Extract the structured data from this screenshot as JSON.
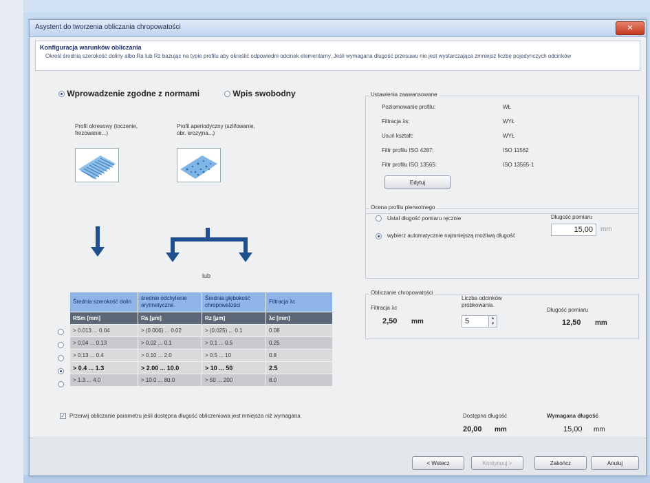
{
  "window": {
    "title": "Asystent do tworzenia obliczania chropowatości",
    "close": "✕"
  },
  "header": {
    "title": "Konfiguracja warunków obliczania",
    "description": "Określ średnią szerokość doliny albo Ra lub Rz bazując na typie profilu aby określić odpowiedni odcinek elementarny. Jeśli wymagana długość przesuwu nie jest wystarczająca zmniejsz liczbę pojedynczych odcinków"
  },
  "mode": {
    "norm_label": "Wprowadzenie zgodne z normami",
    "free_label": "Wpis swobodny",
    "selected": "norm"
  },
  "profiles": {
    "periodic_label": "Profil okresowy (toczenie, frezowanie...)",
    "aperiodic_label": "Profil aperiodyczny (szlifowanie, obr. erozyjna...)",
    "lub": "lub"
  },
  "table": {
    "headers": [
      "Średnia szerokość dolin",
      "średnie odchylenie arytmetyczne",
      "Średnia głębokość chropowatości",
      "Filtracja λc"
    ],
    "units": [
      "RSm [mm]",
      "Ra [μm]",
      "Rz [μm]",
      "λc [mm]"
    ],
    "rows": [
      [
        "> 0.013 ... 0.04",
        "> (0.006) ... 0.02",
        "> (0.025) ... 0.1",
        "0.08"
      ],
      [
        "> 0.04 ... 0.13",
        "> 0.02 ... 0.1",
        "> 0.1 ... 0.5",
        "0.25"
      ],
      [
        "> 0.13 ... 0.4",
        "> 0.10 ... 2.0",
        "> 0.5 ... 10",
        "0.8"
      ],
      [
        "> 0.4 ... 1.3",
        "> 2.00 ... 10.0",
        "> 10 ... 50",
        "2.5"
      ],
      [
        "> 1.3 ... 4.0",
        "> 10.0 ... 80.0",
        "> 50 ... 200",
        "8.0"
      ]
    ],
    "selected_row": 3
  },
  "advanced": {
    "title": "Ustawienia zaawansowane",
    "items": [
      {
        "label": "Poziomowanie profilu:",
        "value": "WŁ"
      },
      {
        "label": "Filtracja λs:",
        "value": "WYŁ"
      },
      {
        "label": "Usuń kształt:",
        "value": "WYŁ"
      },
      {
        "label": "Filtr profilu ISO 4287:",
        "value": "ISO 11562"
      },
      {
        "label": "Filtr profilu ISO 13565:",
        "value": "ISO 13565-1"
      }
    ],
    "edit_button": "Edytuj"
  },
  "primary": {
    "title": "Ocena profilu pierwotnego",
    "manual_label": "Ustal długość pomiaru ręcznie",
    "auto_label": "wybierz automatycznie najmniejszą możliwą długość",
    "length_label": "Długość pomiaru",
    "length_value": "15,00",
    "length_unit": "mm"
  },
  "roughness": {
    "title": "Obliczanie chropowatości",
    "filter_label": "Filtracja λc",
    "filter_value": "2,50",
    "filter_unit": "mm",
    "samples_label": "Liczba odcinków próbkowania",
    "samples_value": "5",
    "length_label": "Długość pomiaru",
    "length_value": "12,50",
    "length_unit": "mm"
  },
  "skip_check": {
    "label": "Przerwij obliczanie parametru jeśli dostępna długość obliczeniowa jest mniejsza niż wymagana",
    "checked": true
  },
  "available": {
    "label": "Dostępna długość",
    "value": "20,00",
    "unit": "mm"
  },
  "required": {
    "label": "Wymagana długość",
    "value": "15,00",
    "unit": "mm"
  },
  "footer": {
    "back": "< Wstecz",
    "next": "Kontynuuj >",
    "finish": "Zakończ",
    "cancel": "Anuluj"
  }
}
